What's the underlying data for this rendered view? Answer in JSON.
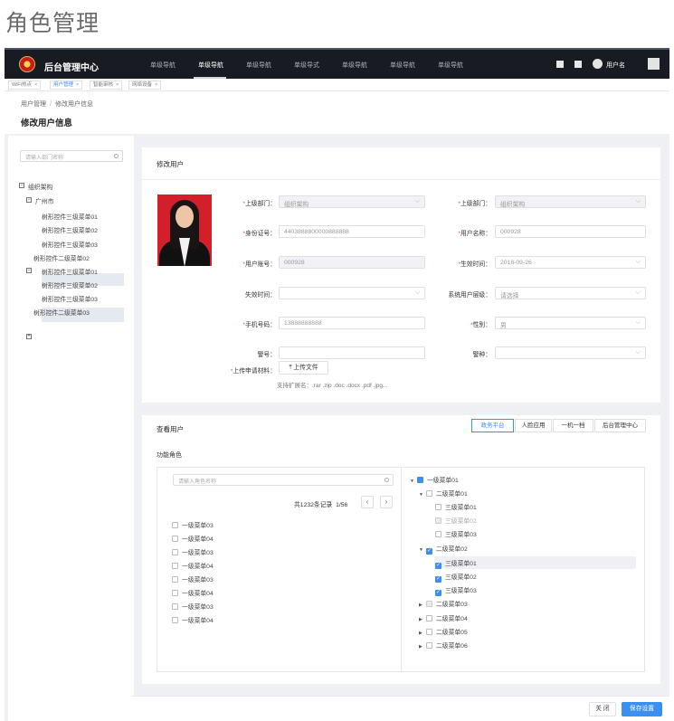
{
  "page_title": "角色管理",
  "nav": {
    "brand": "后台管理中心",
    "items": [
      "单级导航",
      "单级导航",
      "单级导航",
      "单级导式",
      "单级导航",
      "单级导航",
      "单级导航"
    ],
    "user": "用户名"
  },
  "tabs": [
    "WiFi热点",
    "用户管理",
    "智能审核",
    "网络设备"
  ],
  "breadcrumb": {
    "parent": "用户管理",
    "current": "修改用户信息"
  },
  "header_title": "修改用户信息",
  "sidebar": {
    "search_placeholder": "请输入部门名称",
    "tree": [
      "组织架构",
      "广州市",
      "树形控件三级菜单01",
      "树形控件三级菜单02",
      "树形控件三级菜单03",
      "树形控件二级菜单02",
      "树形控件三级菜单01",
      "树形控件三级菜单02",
      "树形控件三级菜单03",
      "树形控件二级菜单03"
    ]
  },
  "form": {
    "title": "修改用户",
    "labels": {
      "dept_l": "上级部门：",
      "id_card": "身份证号：",
      "account": "用户账号：",
      "expire": "失效时间：",
      "phone": "手机号码：",
      "police_no": "警号：",
      "dept_r": "上级部门：",
      "username": "用户名称：",
      "effective": "生效时间：",
      "level": "系统用户层级：",
      "gender": "性别：",
      "police_type": "警种："
    },
    "values": {
      "dept_l": "组织架构",
      "id_card": "4403888800000888888",
      "account": "000928",
      "expire": "",
      "phone": "13888888888",
      "police_no": "",
      "dept_r": "组织架构",
      "username": "000928",
      "effective": "2018-09-26",
      "level": "请选择",
      "gender": "男",
      "police_type": ""
    },
    "upload_label": "上传申请材料：",
    "upload_button": "上传文件",
    "upload_hint": "支持扩展名：.rar .zip .doc .docx .pdf .jpg..."
  },
  "view": {
    "title": "查看用户",
    "tabs": [
      "政务平台",
      "人脸应用",
      "一机一档",
      "后台管理中心"
    ],
    "roles_label": "功能角色",
    "search_placeholder": "请输入角色名称",
    "record_text": "共1232条记录",
    "page_text": "1/56",
    "list": [
      "一级菜单03",
      "一级菜单04",
      "一级菜单03",
      "一级菜单04",
      "一级菜单03",
      "一级菜单04",
      "一级菜单03",
      "一级菜单04"
    ],
    "tree": [
      "一级菜单01",
      "二级菜单01",
      "三级菜单01",
      "三级菜单02",
      "三级菜单03",
      "二级菜单02",
      "三级菜单01",
      "三级菜单02",
      "三级菜单03",
      "二级菜单03",
      "二级菜单04",
      "二级菜单05",
      "二级菜单06"
    ]
  },
  "footer": {
    "close": "关 闭",
    "save": "保存设置"
  },
  "colors": {
    "primary": "#3b8ff1",
    "nav_bg": "#181b22"
  }
}
